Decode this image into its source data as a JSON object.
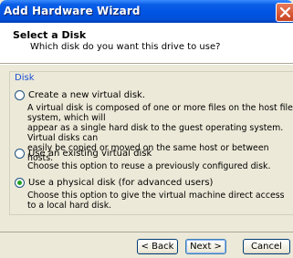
{
  "window": {
    "title": "Add Hardware Wizard"
  },
  "header": {
    "title": "Select a Disk",
    "subtitle": "Which disk do you want this drive to use?"
  },
  "group": {
    "label": "Disk"
  },
  "options": [
    {
      "label": "Create a new virtual disk.",
      "selected": false,
      "description_lines": [
        "A virtual disk is composed of one or more files on the host file system, which will",
        "appear as a single hard disk to the guest operating system. Virtual disks can",
        "easily be copied or moved on the same host or between hosts."
      ]
    },
    {
      "label": "Use an existing virtual disk",
      "selected": false,
      "description_lines": [
        "Choose this option to reuse a previously configured disk."
      ]
    },
    {
      "label": "Use a physical disk (for advanced users)",
      "selected": true,
      "description_lines": [
        "Choose this option to give the virtual machine direct access to a local hard disk."
      ]
    }
  ],
  "buttons": {
    "back": "< Back",
    "next": "Next >",
    "cancel": "Cancel"
  },
  "colors": {
    "titlebar": "#0054e3",
    "group_label": "#1a4fd2",
    "radio_dot": "#21a121"
  }
}
